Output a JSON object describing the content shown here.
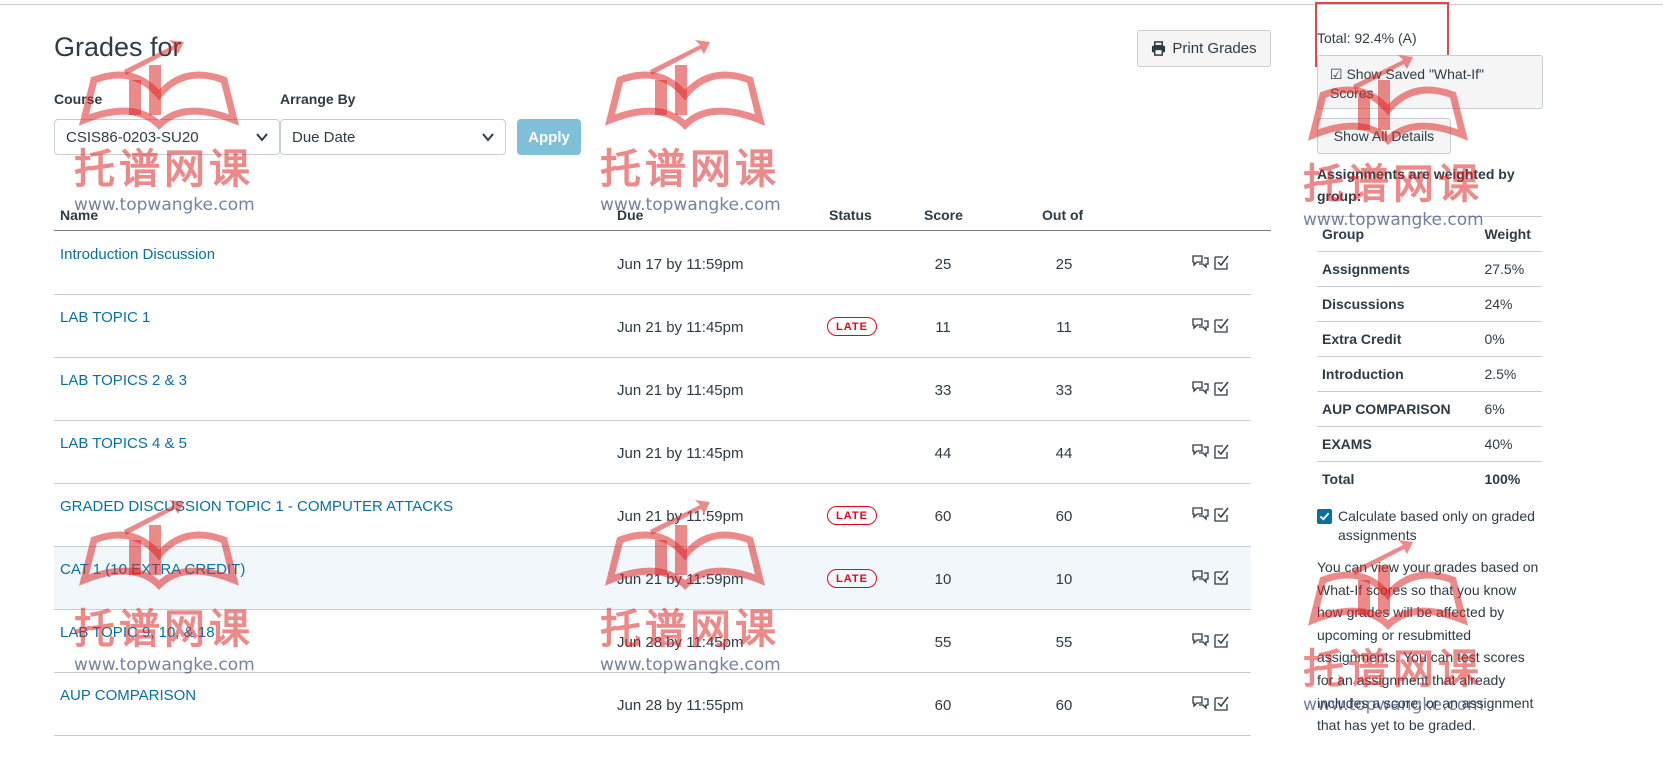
{
  "header": {
    "title": "Grades for",
    "print_label": "Print Grades"
  },
  "filters": {
    "course_label": "Course",
    "course_value": "CSIS86-0203-SU20",
    "arrange_label": "Arrange By",
    "arrange_value": "Due Date",
    "apply_label": "Apply"
  },
  "table": {
    "columns": {
      "name": "Name",
      "due": "Due",
      "status": "Status",
      "score": "Score",
      "out_of": "Out of"
    },
    "rows": [
      {
        "name": "Introduction Discussion",
        "due": "Jun 17 by 11:59pm",
        "status": "",
        "score": "25",
        "out_of": "25"
      },
      {
        "name": "LAB TOPIC 1",
        "due": "Jun 21 by 11:45pm",
        "status": "LATE",
        "score": "11",
        "out_of": "11"
      },
      {
        "name": "LAB TOPICS 2 & 3",
        "due": "Jun 21 by 11:45pm",
        "status": "",
        "score": "33",
        "out_of": "33"
      },
      {
        "name": "LAB TOPICS 4 & 5",
        "due": "Jun 21 by 11:45pm",
        "status": "",
        "score": "44",
        "out_of": "44"
      },
      {
        "name": "GRADED DISCUSSION TOPIC 1 - COMPUTER ATTACKS",
        "due": "Jun 21 by 11:59pm",
        "status": "LATE",
        "score": "60",
        "out_of": "60"
      },
      {
        "name": "CAT 1 (10 EXTRA CREDIT)",
        "due": "Jun 21 by 11:59pm",
        "status": "LATE",
        "score": "10",
        "out_of": "10"
      },
      {
        "name": "LAB TOPIC 9, 10, & 18",
        "due": "Jun 28 by 11:45pm",
        "status": "",
        "score": "55",
        "out_of": "55"
      },
      {
        "name": "AUP COMPARISON",
        "due": "Jun 28 by 11:55pm",
        "status": "",
        "score": "60",
        "out_of": "60"
      }
    ]
  },
  "sidebar": {
    "total": "Total: 92.4% (A)",
    "show_saved_label": "Show Saved \"What-If\" Scores",
    "show_details_label": "Show All Details",
    "weighted_note": "Assignments are weighted by group:",
    "weights_header": {
      "group": "Group",
      "weight": "Weight"
    },
    "weights": [
      {
        "group": "Assignments",
        "weight": "27.5%"
      },
      {
        "group": "Discussions",
        "weight": "24%"
      },
      {
        "group": "Extra Credit",
        "weight": "0%"
      },
      {
        "group": "Introduction",
        "weight": "2.5%"
      },
      {
        "group": "AUP COMPARISON",
        "weight": "6%"
      },
      {
        "group": "EXAMS",
        "weight": "40%"
      }
    ],
    "weights_total": {
      "group": "Total",
      "weight": "100%"
    },
    "calc_checked": true,
    "calc_label": "Calculate based only on graded assignments",
    "help_text": "You can view your grades based on What-If scores so that you know how grades will be affected by upcoming or resubmitted assignments. You can test scores for an assignment that already includes a score, or an assignment that has yet to be graded."
  },
  "watermark": {
    "text_zh": "托谱网课",
    "url": "www.topwangke.com"
  },
  "colors": {
    "link": "#0770a3",
    "late": "#e0061f",
    "apply": "#7fbfd8",
    "highlight_box": "#e0464a"
  }
}
